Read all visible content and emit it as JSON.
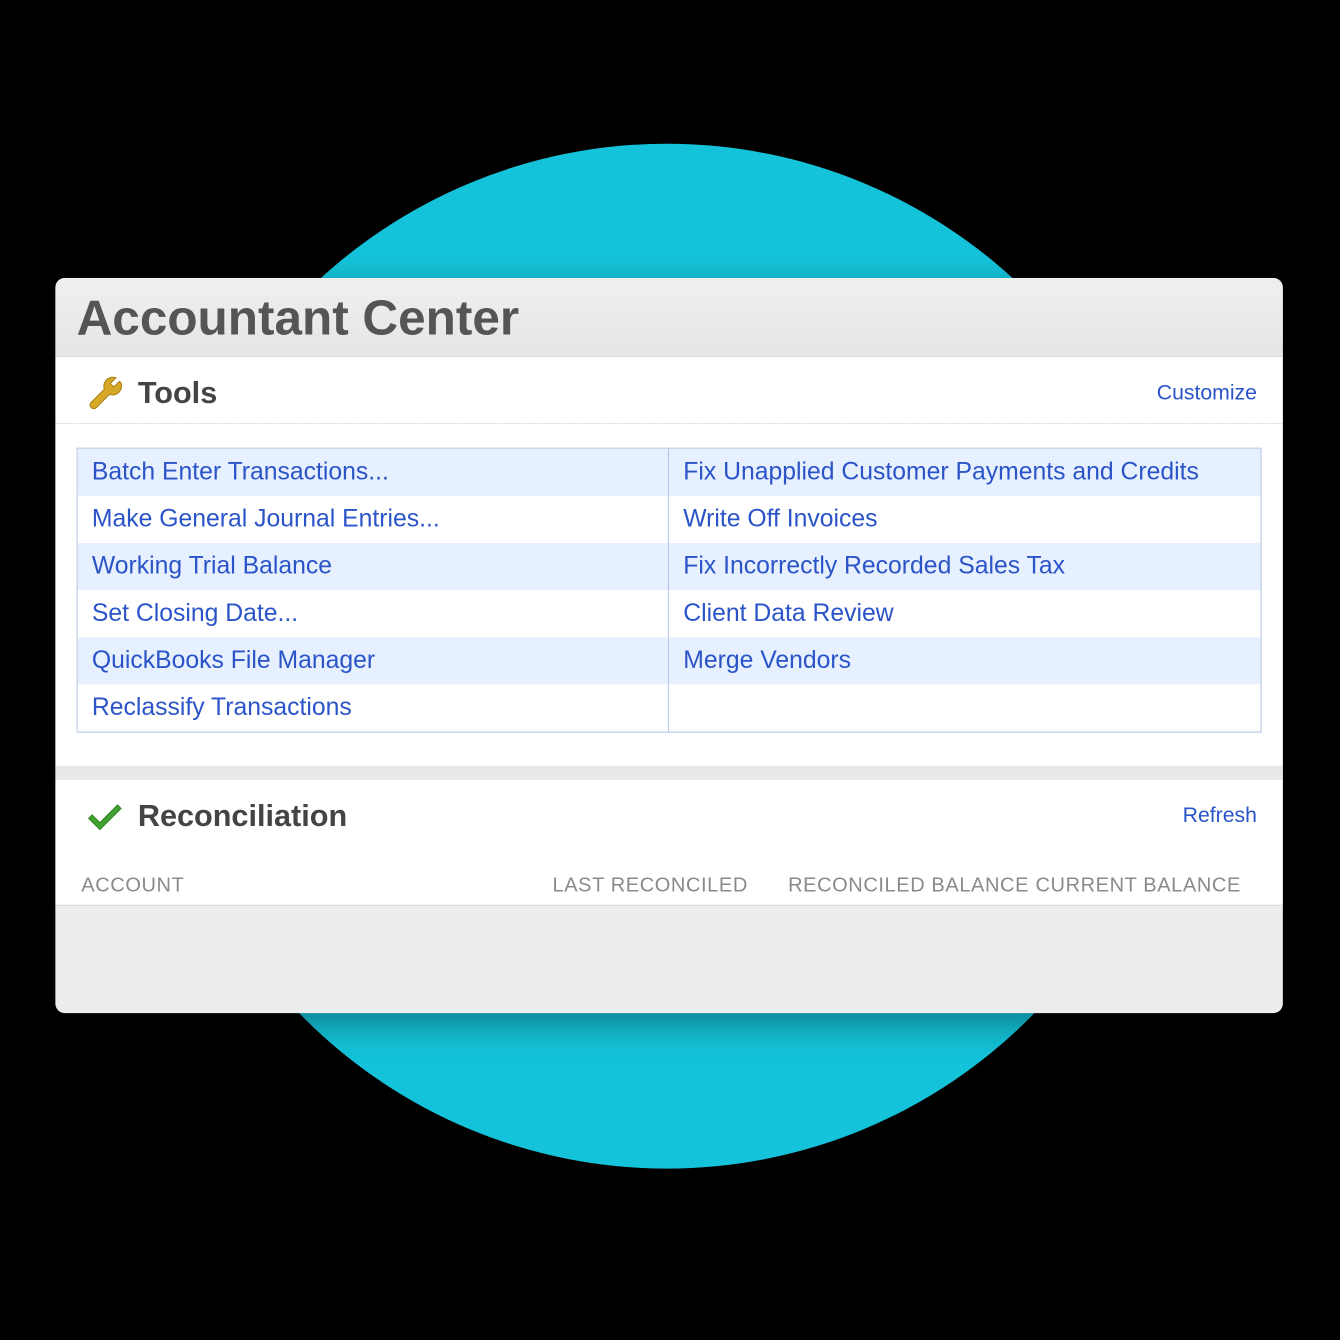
{
  "window": {
    "title": "Accountant Center"
  },
  "tools": {
    "title": "Tools",
    "customize_label": "Customize",
    "rows": [
      {
        "left": "Batch Enter Transactions...",
        "right": "Fix Unapplied Customer Payments and Credits"
      },
      {
        "left": "Make General Journal Entries...",
        "right": "Write Off Invoices"
      },
      {
        "left": "Working Trial Balance",
        "right": "Fix Incorrectly Recorded Sales Tax"
      },
      {
        "left": "Set Closing Date...",
        "right": "Client Data Review"
      },
      {
        "left": "QuickBooks File Manager",
        "right": "Merge Vendors"
      },
      {
        "left": "Reclassify Transactions",
        "right": ""
      }
    ]
  },
  "reconciliation": {
    "title": "Reconciliation",
    "refresh_label": "Refresh",
    "columns": {
      "account": "ACCOUNT",
      "last_reconciled": "LAST RECONCILED",
      "reconciled_balance": "RECONCILED BALANCE",
      "current_balance": "CURRENT BALANCE"
    }
  },
  "colors": {
    "accent_circle": "#14c3d9",
    "link": "#2a54c8",
    "stripe": "#e7f0ff"
  }
}
